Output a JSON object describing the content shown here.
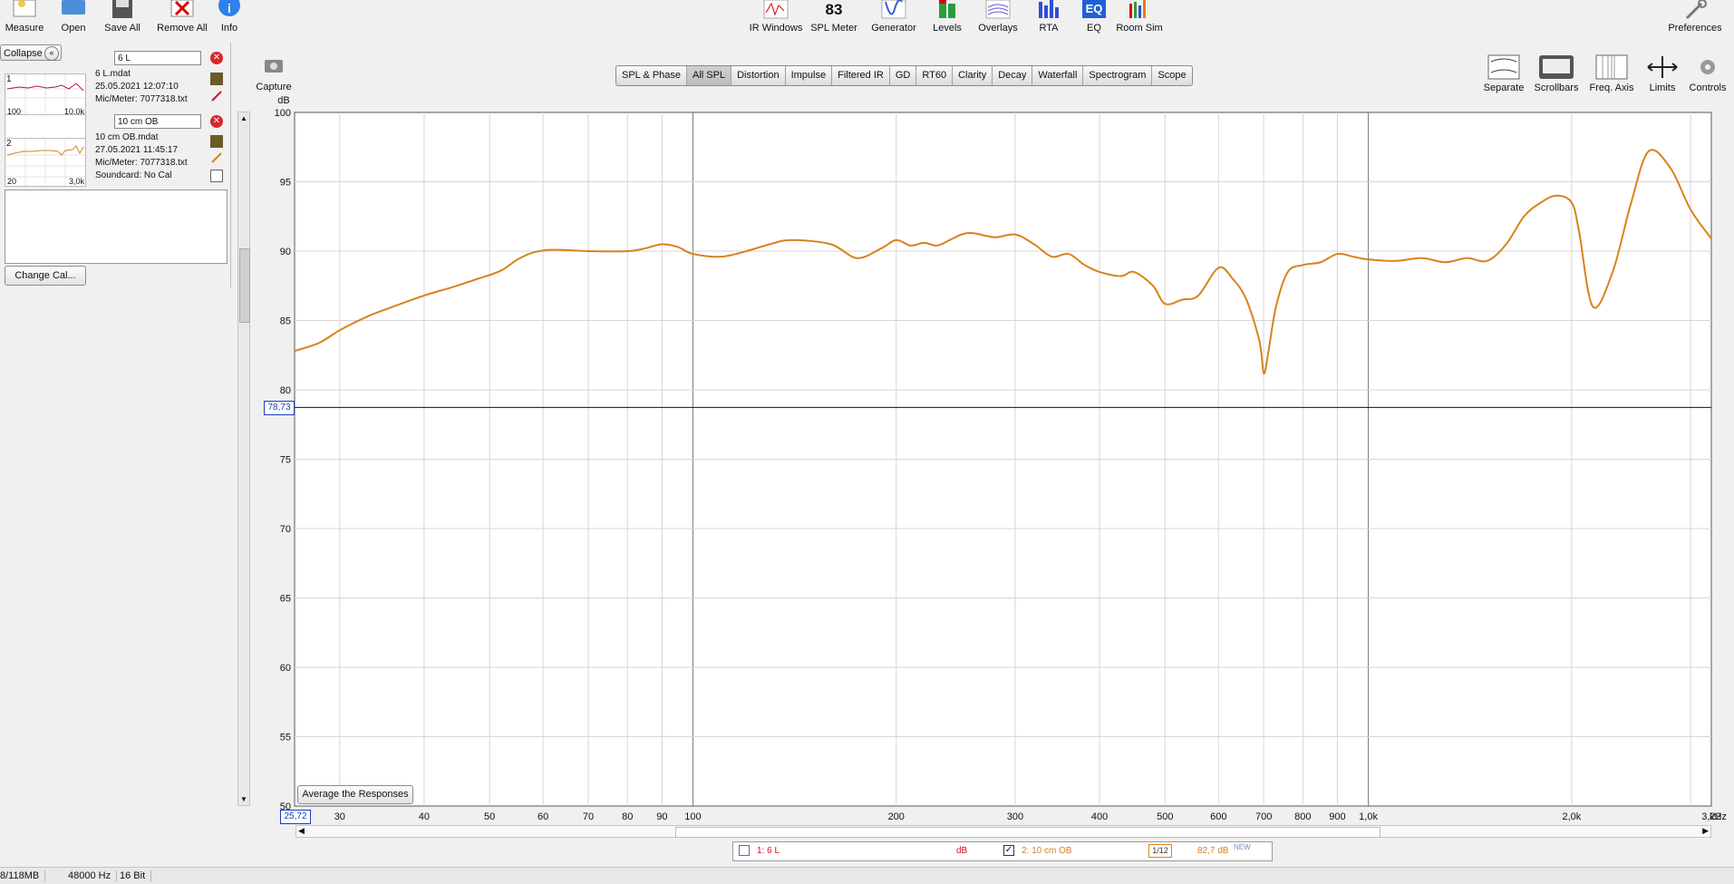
{
  "toolbar": {
    "left": [
      {
        "label": "Measure",
        "icon": "measure-icon"
      },
      {
        "label": "Open",
        "icon": "folder-icon"
      },
      {
        "label": "Save All",
        "icon": "save-icon"
      },
      {
        "label": "Remove All",
        "icon": "remove-icon"
      },
      {
        "label": "Info",
        "icon": "info-icon"
      }
    ],
    "center": [
      {
        "label": "IR Windows",
        "icon": "ir-windows-icon"
      },
      {
        "label": "SPL Meter",
        "icon": "spl-meter-icon",
        "badge": "83"
      },
      {
        "label": "Generator",
        "icon": "generator-icon"
      },
      {
        "label": "Levels",
        "icon": "levels-icon"
      },
      {
        "label": "Overlays",
        "icon": "overlays-icon"
      },
      {
        "label": "RTA",
        "icon": "rta-icon"
      },
      {
        "label": "EQ",
        "icon": "eq-icon",
        "badge": "EQ"
      },
      {
        "label": "Room Sim",
        "icon": "room-sim-icon"
      }
    ],
    "preferences": "Preferences",
    "capture": "Capture"
  },
  "collapse_label": "Collapse",
  "change_cal_label": "Change Cal...",
  "measurements": [
    {
      "index": "1",
      "name": "6 L",
      "file": "6 L.mdat",
      "date": "25.05.2021 12:07:10",
      "mic": "Mic/Meter: 7077318.txt",
      "thumb_left": "100",
      "thumb_right": "10,0k",
      "color": "#c8102e"
    },
    {
      "index": "2",
      "name": "10 cm OB",
      "file": "10 cm OB.mdat",
      "date": "27.05.2021 11:45:17",
      "mic": "Mic/Meter: 7077318.txt",
      "soundcard": "Soundcard: No Cal",
      "thumb_left": "20",
      "thumb_right": "3,0k",
      "color": "#d9821a"
    }
  ],
  "tabs": [
    "SPL & Phase",
    "All SPL",
    "Distortion",
    "Impulse",
    "Filtered IR",
    "GD",
    "RT60",
    "Clarity",
    "Decay",
    "Waterfall",
    "Spectrogram",
    "Scope"
  ],
  "active_tab": "All SPL",
  "right_tools": [
    "Separate",
    "Scrollbars",
    "Freq. Axis",
    "Limits",
    "Controls"
  ],
  "average_button": "Average the Responses",
  "cursor": {
    "y_readout": "78,73",
    "x_readout": "25,72"
  },
  "legend": {
    "item1": "1: 6 L",
    "item1_unit": "dB",
    "item2": "2: 10 cm OB",
    "item2_smoothing": "1/12",
    "item2_value": "82,7 dB",
    "item2_new": "NEW"
  },
  "status": {
    "memory": "8/118MB",
    "rate": "48000 Hz",
    "bits": "16 Bit"
  },
  "chart_data": {
    "type": "line",
    "ylabel": "dB",
    "xlabel": "",
    "x_unit": "kHz",
    "x_scale": "log",
    "xlim": [
      25.72,
      3220
    ],
    "ylim": [
      50,
      100
    ],
    "y_ticks": [
      "100",
      "95",
      "90",
      "85",
      "80",
      "75",
      "70",
      "65",
      "60",
      "55",
      "50"
    ],
    "x_ticks": [
      {
        "v": 30,
        "t": "30"
      },
      {
        "v": 40,
        "t": "40"
      },
      {
        "v": 50,
        "t": "50"
      },
      {
        "v": 60,
        "t": "60"
      },
      {
        "v": 70,
        "t": "70"
      },
      {
        "v": 80,
        "t": "80"
      },
      {
        "v": 90,
        "t": "90"
      },
      {
        "v": 100,
        "t": "100"
      },
      {
        "v": 200,
        "t": "200"
      },
      {
        "v": 300,
        "t": "300"
      },
      {
        "v": 400,
        "t": "400"
      },
      {
        "v": 500,
        "t": "500"
      },
      {
        "v": 600,
        "t": "600"
      },
      {
        "v": 700,
        "t": "700"
      },
      {
        "v": 800,
        "t": "800"
      },
      {
        "v": 900,
        "t": "900"
      },
      {
        "v": 1000,
        "t": "1,0k"
      },
      {
        "v": 2000,
        "t": "2,0k"
      },
      {
        "v": 3220,
        "t": "3,22"
      }
    ],
    "grid": true,
    "cursor_y": 78.73,
    "series": [
      {
        "name": "2: 10 cm OB",
        "color": "#d9821a",
        "x": [
          25.72,
          28,
          30,
          33,
          36,
          40,
          44,
          48,
          52,
          55,
          58,
          62,
          70,
          80,
          85,
          90,
          95,
          100,
          110,
          120,
          130,
          140,
          160,
          175,
          190,
          200,
          210,
          220,
          230,
          240,
          250,
          260,
          280,
          300,
          320,
          340,
          360,
          380,
          400,
          430,
          450,
          480,
          500,
          530,
          560,
          600,
          630,
          660,
          690,
          700,
          710,
          730,
          760,
          800,
          850,
          900,
          950,
          1000,
          1100,
          1200,
          1300,
          1400,
          1500,
          1600,
          1700,
          1800,
          1900,
          2000,
          2050,
          2150,
          2300,
          2450,
          2600,
          2800,
          3000,
          3220
        ],
        "y": [
          82.8,
          83.4,
          84.3,
          85.3,
          86,
          86.8,
          87.4,
          88,
          88.6,
          89.4,
          89.9,
          90.1,
          90,
          90,
          90.2,
          90.5,
          90.3,
          89.8,
          89.6,
          90,
          90.5,
          90.8,
          90.5,
          89.5,
          90.2,
          90.8,
          90.4,
          90.6,
          90.4,
          90.8,
          91.2,
          91.3,
          91,
          91.2,
          90.5,
          89.6,
          89.8,
          89,
          88.5,
          88.2,
          88.5,
          87.5,
          86.2,
          86.5,
          86.8,
          88.8,
          88,
          86.5,
          83.5,
          81.2,
          82.5,
          86,
          88.5,
          89,
          89.2,
          89.8,
          89.6,
          89.4,
          89.3,
          89.5,
          89.2,
          89.5,
          89.3,
          90.5,
          92.5,
          93.5,
          94,
          93.5,
          91.5,
          86,
          88.5,
          93.5,
          97.2,
          96,
          93,
          90.9
        ]
      }
    ]
  }
}
